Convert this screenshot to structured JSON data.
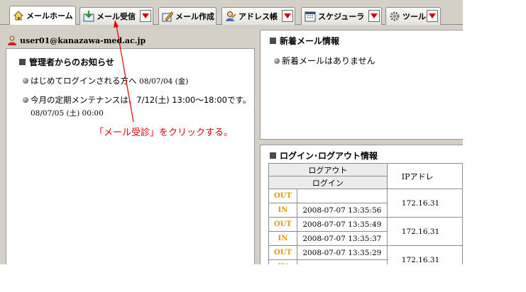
{
  "tabs": [
    {
      "label": "メールホーム",
      "icon": "home-icon",
      "active": true,
      "dropdown": false
    },
    {
      "label": "メール受信",
      "icon": "mail-receive-icon",
      "active": false,
      "dropdown": true
    },
    {
      "label": "メール作成",
      "icon": "mail-compose-icon",
      "active": false,
      "dropdown": false
    },
    {
      "label": "アドレス帳",
      "icon": "address-book-icon",
      "active": false,
      "dropdown": true
    },
    {
      "label": "スケジューラ",
      "icon": "calendar-icon",
      "active": false,
      "dropdown": true
    },
    {
      "label": "ツール",
      "icon": "gear-icon",
      "active": false,
      "dropdown": true
    }
  ],
  "user": {
    "email": "user01@kanazawa-med.ac.jp",
    "icon": "user-icon"
  },
  "notices": {
    "title": "管理者からのお知らせ",
    "items": [
      {
        "text": "はじめてログインされる方へ",
        "date": "08/07/04 (金)"
      },
      {
        "text": "今月の定期メンテナンスは、7/12(土) 13:00〜18:00です。",
        "date": "08/07/05 (土) 00:00"
      }
    ]
  },
  "annotation": "「メール受診」をクリックする。",
  "new_mail": {
    "title": "新着メール情報",
    "message": "新着メールはありません"
  },
  "login_log": {
    "title": "ログイン･ログアウト情報",
    "header_logout": "ログアウト",
    "header_login": "ログイン",
    "header_ip": "IPアドレ",
    "rows": [
      {
        "out": "",
        "in": "2008-07-07 13:35:56",
        "ip": "172.16.31"
      },
      {
        "out": "2008-07-07 13:35:49",
        "in": "2008-07-07 13:35:37",
        "ip": "172.16.31"
      },
      {
        "out": "2008-07-07 13:35:29",
        "in": "",
        "ip": "172.16.31"
      }
    ],
    "out_label": "OUT",
    "in_label": "IN"
  },
  "colors": {
    "annotation": "#e60000",
    "out_in": "#e69a00",
    "dropdown_arrow": "#d40000"
  }
}
